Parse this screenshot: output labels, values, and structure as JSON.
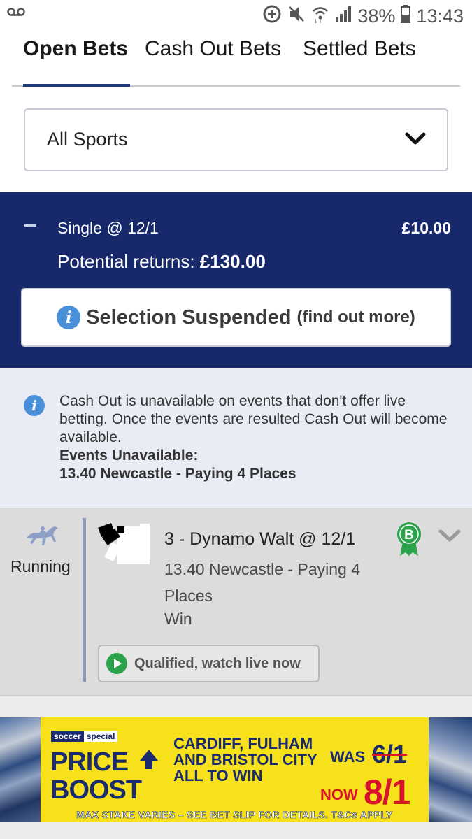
{
  "status_bar": {
    "battery": "38%",
    "time": "13:43",
    "icons": [
      "voicemail-icon",
      "data-saver-icon",
      "mute-icon",
      "wifi-icon",
      "signal-icon",
      "battery-icon"
    ]
  },
  "tabs": [
    {
      "label": "Open Bets",
      "active": true
    },
    {
      "label": "Cash Out Bets",
      "active": false
    },
    {
      "label": "Settled Bets",
      "active": false
    }
  ],
  "filter": {
    "selected": "All Sports"
  },
  "bet": {
    "type": "Single @ 12/1",
    "stake": "£10.00",
    "returns_label": "Potential returns:",
    "returns_amount": "£130.00",
    "suspended_title": "Selection Suspended",
    "suspended_link": "(find out more)"
  },
  "notice": {
    "message": "Cash Out is unavailable on events that don't offer live betting. Once the events are resulted Cash Out will become available.",
    "unavailable_label": "Events Unavailable:",
    "unavailable_event": "13.40 Newcastle - Paying 4 Places"
  },
  "selection": {
    "status": "Running",
    "name": "3 - Dynamo Walt @ 12/1",
    "event": "13.40 Newcastle - Paying 4 Places",
    "market": "Win",
    "badge": "B",
    "watch_label": "Qualified, watch live now"
  },
  "banner": {
    "brand_a": "soccer",
    "brand_b": "special",
    "headline_line1": "PRICE",
    "headline_line2": "BOOST",
    "offer": "CARDIFF, FULHAM AND BRISTOL CITY ALL TO WIN",
    "was_label": "WAS",
    "was_odds": "6/1",
    "now_label": "NOW",
    "now_odds": "8/1",
    "terms": "MAX STAKE VARIES – SEE BET SLIP FOR DETAILS. T&Cs APPLY"
  },
  "colors": {
    "navy": "#17296b",
    "info_blue": "#4a90d9",
    "green": "#2aa34a",
    "banner_yellow": "#f7e11d",
    "banner_red": "#d7142c"
  }
}
